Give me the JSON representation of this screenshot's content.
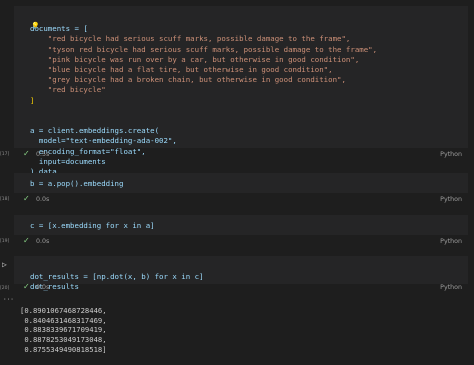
{
  "cells": [
    {
      "exec_count": "[17]",
      "lines": [
        "documents = [",
        "    \"red bicycle had serious scuff marks, possible damage to the frame\",",
        "    \"tyson red bicycle had serious scuff marks, possible damage to the frame\",",
        "    \"pink bicycle was run over by a car, but otherwise in good condition\",",
        "    \"blue bicycle had a flat tire, but otherwise in good condition\",",
        "    \"grey bicycle had a broken chain, but otherwise in good condition\",",
        "    \"red bicycle\"",
        "]",
        "",
        "",
        "a = client.embeddings.create(",
        "  model=\"text-embedding-ada-002\",",
        "  encoding_format=\"float\",",
        "  input=documents",
        ").data"
      ],
      "time": "0.5s",
      "language": "Python"
    },
    {
      "exec_count": "[18]",
      "lines": [
        "b = a.pop().embedding"
      ],
      "time": "0.0s",
      "language": "Python"
    },
    {
      "exec_count": "[19]",
      "lines": [
        "c = [x.embedding for x in a]"
      ],
      "time": "0.0s",
      "language": "Python"
    },
    {
      "exec_count": "[20]",
      "lines": [
        "dot_results = [np.dot(x, b) for x in c]",
        "dot_results"
      ],
      "time": "0.0s",
      "language": "Python"
    }
  ],
  "output": {
    "lines": [
      "[0.8901067468728446,",
      " 0.8404631468317469,",
      " 0.8838339671709419,",
      " 0.8878253049173048,",
      " 0.8755349490818518]"
    ]
  },
  "icons": {
    "lightbulb": "lightbulb-icon",
    "check": "check-icon",
    "run": "run-icon",
    "ellipsis": "ellipsis-icon"
  },
  "colors": {
    "background": "#1e1e1e",
    "cell_background": "#252526",
    "success": "#89d185",
    "string": "#ce9178",
    "variable": "#9cdcfe"
  }
}
